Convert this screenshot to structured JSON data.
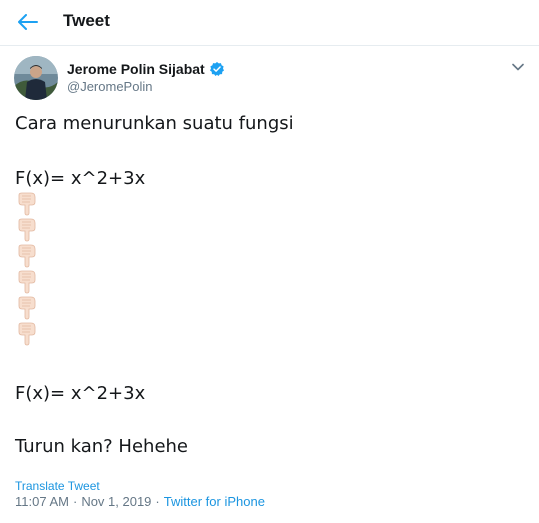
{
  "header": {
    "title": "Tweet",
    "back_icon": "arrow-left-icon",
    "accent_color": "#1da1f2"
  },
  "author": {
    "name": "Jerome Polin Sijabat",
    "handle": "@JeromePolin",
    "verified_icon": "verified-badge-icon",
    "verified_color": "#1da1f2"
  },
  "menu_icon": "chevron-down-icon",
  "tweet": {
    "line1": "Cara menurunkan suatu fungsi",
    "line2": "F(x)= x^2+3x",
    "emoji_icon": "backhand-index-pointing-down-icon",
    "emoji_count": 6,
    "line3": "F(x)= x^2+3x",
    "line4": "Turun kan? Hehehe"
  },
  "footer": {
    "translate_label": "Translate Tweet",
    "time": "11:07 AM",
    "date": "Nov 1, 2019",
    "separator": "·",
    "source": "Twitter for iPhone",
    "link_color": "#1b95e0"
  }
}
